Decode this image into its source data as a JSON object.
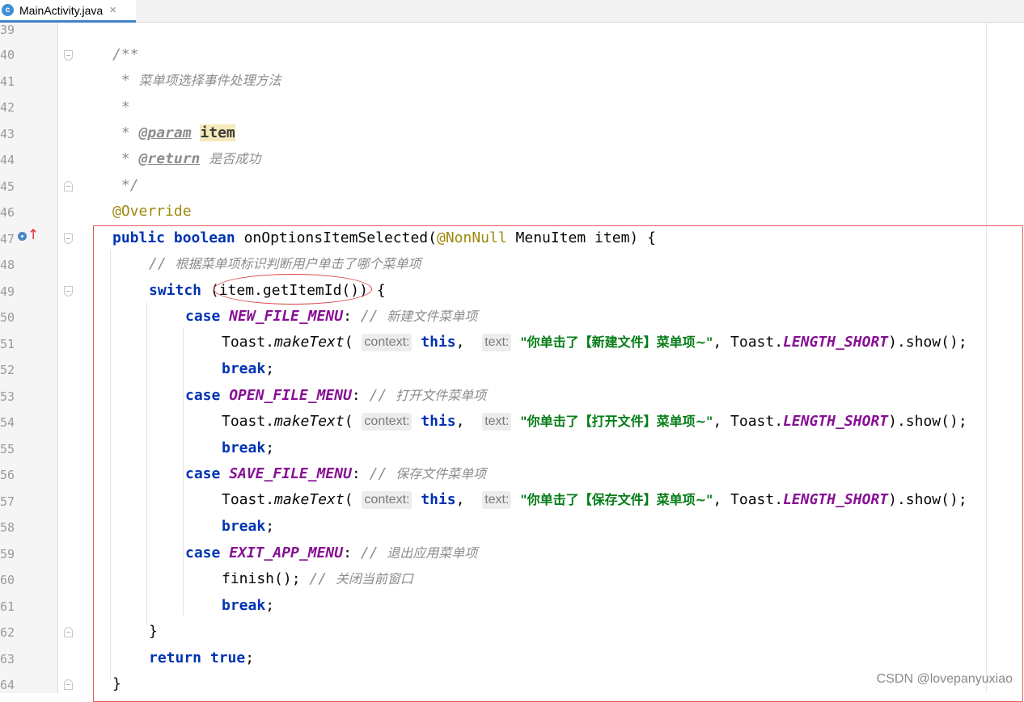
{
  "tab": {
    "icon": "c",
    "title": "MainActivity.java",
    "close": "×"
  },
  "line_numbers": [
    "39",
    "40",
    "41",
    "42",
    "43",
    "44",
    "45",
    "46",
    "47",
    "48",
    "49",
    "50",
    "51",
    "52",
    "53",
    "54",
    "55",
    "56",
    "57",
    "58",
    "59",
    "60",
    "61",
    "62",
    "63",
    "64"
  ],
  "code": {
    "l40": "/**",
    "l41_star": " * ",
    "l41_text": "菜单项选择事件处理方法",
    "l42": " *",
    "l43_star": " * ",
    "l43_tag": "@param",
    "l43_param": "item",
    "l44_star": " * ",
    "l44_tag": "@return",
    "l44_text": "是否成功",
    "l45": " */",
    "l46": "@Override",
    "l47_kw1": "public",
    "l47_kw2": "boolean",
    "l47_name": " onOptionsItemSelected(",
    "l47_anno": "@NonNull",
    "l47_rest": " MenuItem item) {",
    "l48_cmt": "// ",
    "l48_text": "根据菜单项标识判断用户单击了哪个菜单项",
    "l49_kw": "switch",
    "l49_rest": " (item.getItemId()) {",
    "case_kw": "case",
    "break_kw": "break",
    "semicolon": ";",
    "colon": ":",
    "toast_prefix": "Toast.",
    "make_text": "makeText",
    "open_paren": "(",
    "hint_context": "context:",
    "this_kw": "this",
    "comma": ",",
    "hint_text": "text:",
    "length_short": "LENGTH_SHORT",
    "toast_suffix": ").show();",
    "comment_slashes": "// ",
    "cases": [
      {
        "const": "NEW_FILE_MENU",
        "comment": "新建文件菜单项",
        "str": "\"你单击了【新建文件】菜单项~\""
      },
      {
        "const": "OPEN_FILE_MENU",
        "comment": "打开文件菜单项",
        "str": "\"你单击了【打开文件】菜单项~\""
      },
      {
        "const": "SAVE_FILE_MENU",
        "comment": "保存文件菜单项",
        "str": "\"你单击了【保存文件】菜单项~\""
      },
      {
        "const": "EXIT_APP_MENU",
        "comment": "退出应用菜单项"
      }
    ],
    "l60_call": "finish();",
    "l60_text": "关闭当前窗口",
    "l62": "}",
    "l63_kw1": "return",
    "l63_kw2": "true",
    "l64": "}"
  },
  "watermark": "CSDN @lovepanyuxiao",
  "colors": {
    "keyword": "#0033b3",
    "comment": "#8c8c8c",
    "string": "#067d17",
    "constant": "#871094",
    "annotation": "#9e880d",
    "highlight_box": "#e55b5b"
  }
}
